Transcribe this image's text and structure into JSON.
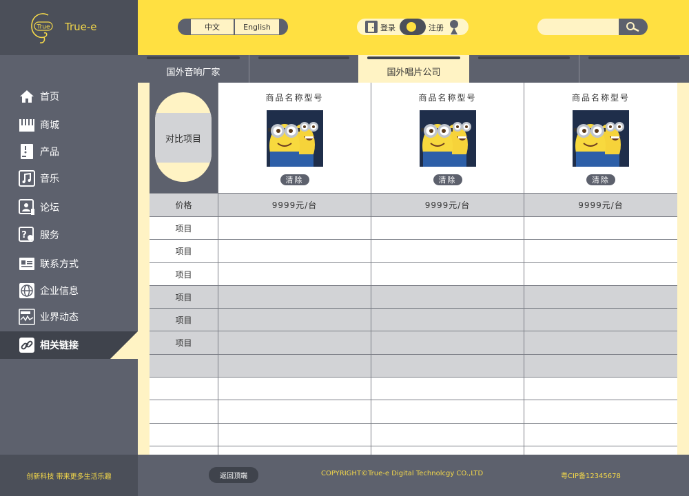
{
  "brand": {
    "logo_mark": "True",
    "name": "True-e"
  },
  "sidebar": {
    "items": [
      {
        "label": "首页",
        "icon": "home-icon"
      },
      {
        "label": "商城",
        "icon": "store-icon"
      },
      {
        "label": "产品",
        "icon": "product-icon"
      },
      {
        "label": "音乐",
        "icon": "music-icon"
      },
      {
        "label": "论坛",
        "icon": "forum-icon"
      },
      {
        "label": "服务",
        "icon": "service-icon"
      },
      {
        "label": "联系方式",
        "icon": "contact-card-icon"
      },
      {
        "label": "企业信息",
        "icon": "globe-icon"
      },
      {
        "label": "业界动态",
        "icon": "news-icon"
      },
      {
        "label": "相关链接",
        "icon": "link-icon",
        "active": true
      }
    ]
  },
  "header": {
    "lang_zh": "中文",
    "lang_en": "English",
    "login": "登录",
    "register": "注册",
    "search_placeholder": ""
  },
  "tabs": [
    {
      "label": "国外音响厂家",
      "active": false
    },
    {
      "label": "",
      "active": false
    },
    {
      "label": "国外唱片公司",
      "active": true
    },
    {
      "label": "",
      "active": false
    },
    {
      "label": "",
      "active": false
    }
  ],
  "compare": {
    "header_label": "对比项目",
    "products": [
      {
        "name": "商品名称型号",
        "clear": "清除",
        "image": "minions-product-image"
      },
      {
        "name": "商品名称型号",
        "clear": "清除",
        "image": "minions-product-image"
      },
      {
        "name": "商品名称型号",
        "clear": "清除",
        "image": "minions-product-image"
      }
    ],
    "price_label": "价格",
    "prices": [
      "9999元/台",
      "9999元/台",
      "9999元/台"
    ],
    "rows": [
      {
        "label": "项目",
        "gray": false
      },
      {
        "label": "项目",
        "gray": false
      },
      {
        "label": "项目",
        "gray": false
      },
      {
        "label": "项目",
        "gray": true
      },
      {
        "label": "项目",
        "gray": true
      },
      {
        "label": "项目",
        "gray": true
      },
      {
        "label": "",
        "gray": true
      },
      {
        "label": "",
        "gray": false
      },
      {
        "label": "",
        "gray": false
      },
      {
        "label": "",
        "gray": false
      }
    ]
  },
  "footer": {
    "slogan": "创新科技  带来更多生活乐趣",
    "back_to_top": "返回顶端",
    "copyright": "COPYRIGHT©True-e Digital Technolcgy CO.,LTD",
    "icp": "粤CIP备12345678"
  },
  "colors": {
    "yellow": "#ffe041",
    "light_yellow": "#fff3c4",
    "dark_gray": "#5d616d",
    "darker_gray": "#3f434c"
  }
}
